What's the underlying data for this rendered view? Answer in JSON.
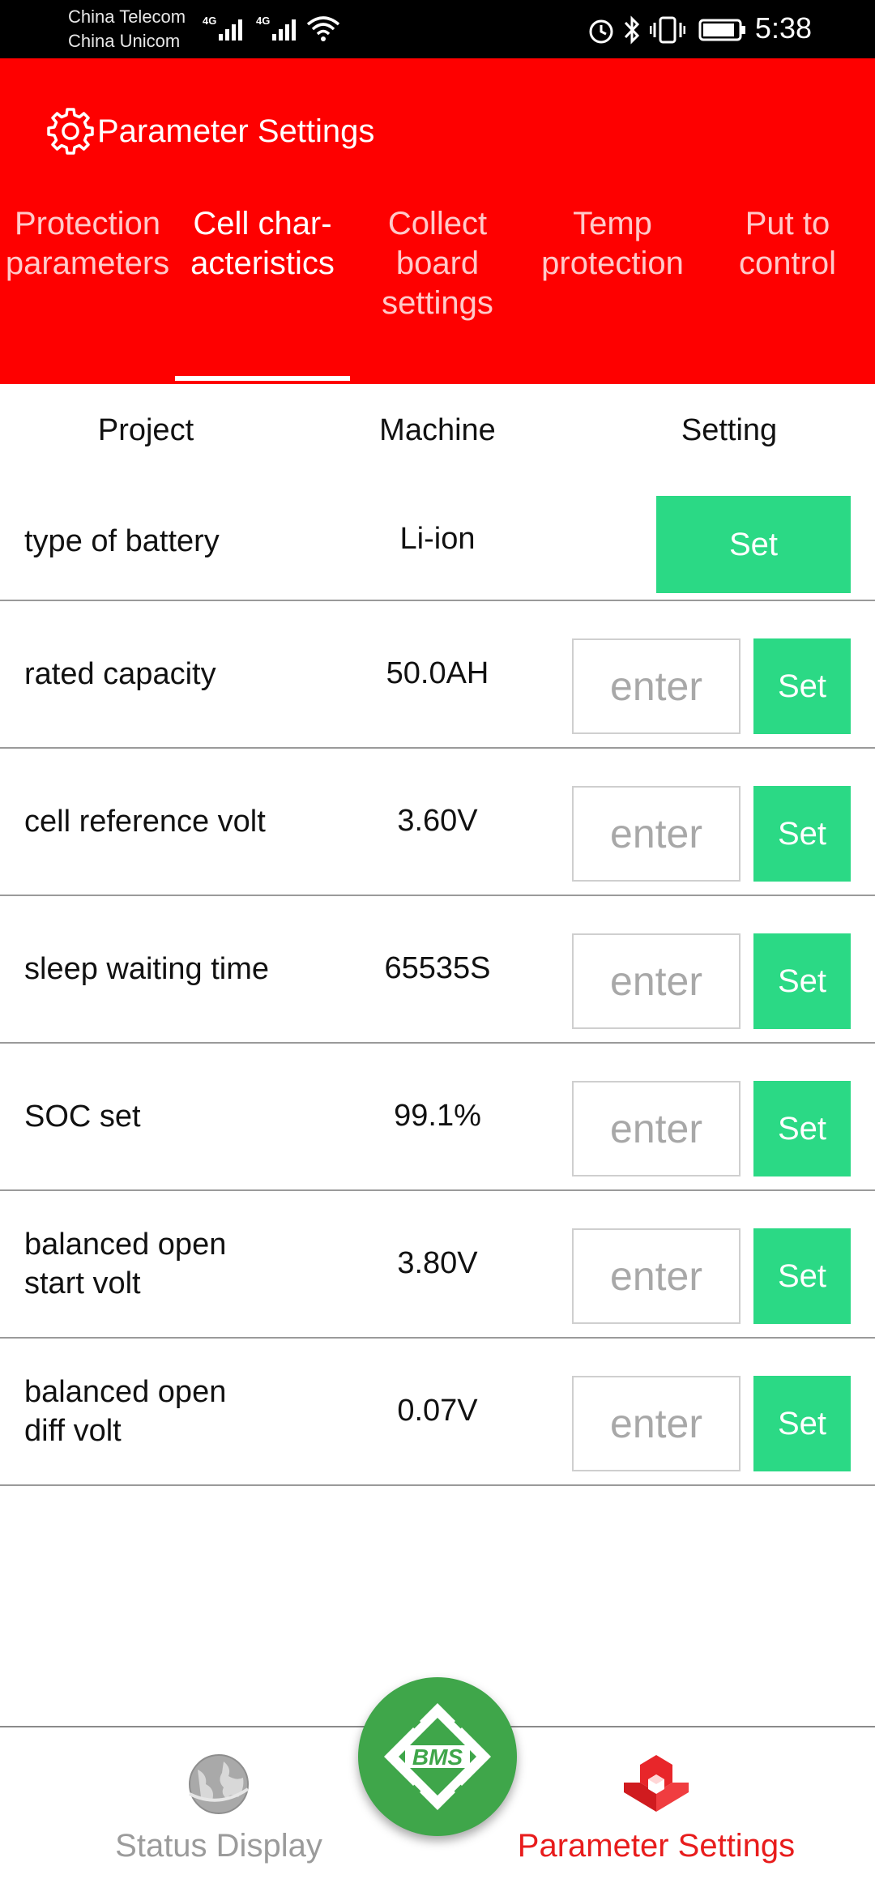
{
  "status_bar": {
    "carrier_1": "China Telecom",
    "carrier_2": "China Unicom",
    "network_1": "4G",
    "network_2": "4G",
    "time": "5:38"
  },
  "header": {
    "title": "Parameter Settings",
    "icon": "gear-icon",
    "background_color": "#fe0000"
  },
  "tabs": [
    {
      "line1": "Protection",
      "line2": "parameters",
      "line3": "",
      "active": false
    },
    {
      "line1": "Cell char-",
      "line2": "acteristics",
      "line3": "",
      "active": true
    },
    {
      "line1": "Collect",
      "line2": "board",
      "line3": "settings",
      "active": false
    },
    {
      "line1": "Temp",
      "line2": "protection",
      "line3": "",
      "active": false
    },
    {
      "line1": "Put to",
      "line2": "control",
      "line3": "",
      "active": false
    }
  ],
  "table": {
    "headers": {
      "project": "Project",
      "machine": "Machine",
      "setting": "Setting"
    },
    "rows": [
      {
        "line1": "type of battery",
        "line2": "",
        "machine": "Li-ion",
        "has_input": false,
        "button": "Set"
      },
      {
        "line1": "rated capacity",
        "line2": "",
        "machine": "50.0AH",
        "has_input": true,
        "placeholder": "enter",
        "button": "Set"
      },
      {
        "line1": "cell reference volt",
        "line2": "",
        "machine": "3.60V",
        "has_input": true,
        "placeholder": "enter",
        "button": "Set"
      },
      {
        "line1": "sleep waiting time",
        "line2": "",
        "machine": "65535S",
        "has_input": true,
        "placeholder": "enter",
        "button": "Set"
      },
      {
        "line1": "SOC set",
        "line2": "",
        "machine": "99.1%",
        "has_input": true,
        "placeholder": "enter",
        "button": "Set"
      },
      {
        "line1": "balanced open",
        "line2": "start volt",
        "machine": "3.80V",
        "has_input": true,
        "placeholder": "enter",
        "button": "Set"
      },
      {
        "line1": "balanced open",
        "line2": "diff volt",
        "machine": "0.07V",
        "has_input": true,
        "placeholder": "enter",
        "button": "Set"
      }
    ],
    "button_color": "#2bd985"
  },
  "bottom_nav": {
    "status_label": "Status Display",
    "status_icon": "globe-icon",
    "center_logo": "BMS",
    "param_label": "Parameter Settings",
    "param_icon": "cubes-icon",
    "active_color": "#e81c1c",
    "inactive_color": "#9b9b9b"
  }
}
